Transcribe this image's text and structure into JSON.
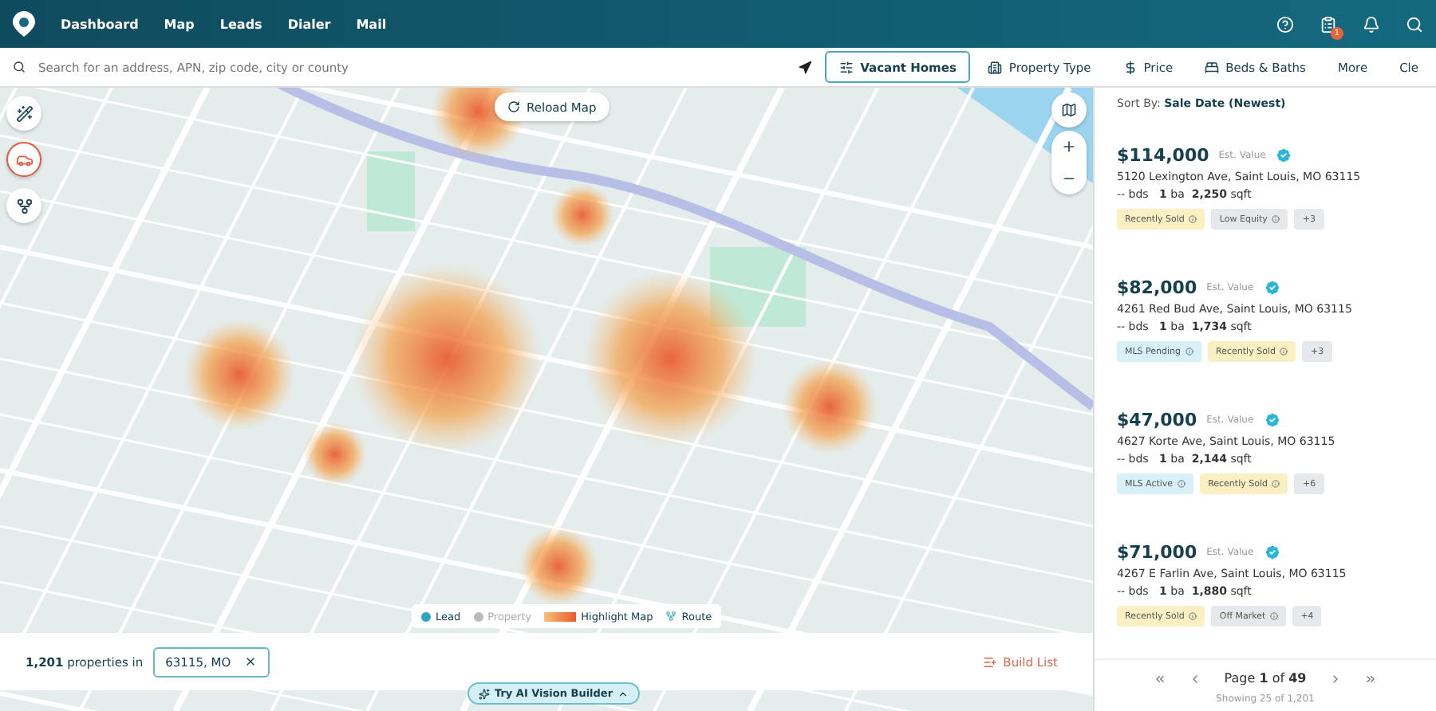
{
  "nav": {
    "items": [
      {
        "label": "Dashboard"
      },
      {
        "label": "Map"
      },
      {
        "label": "Leads"
      },
      {
        "label": "Dialer"
      },
      {
        "label": "Mail"
      }
    ],
    "notification_count": "1"
  },
  "search": {
    "placeholder": "Search for an address, APN, zip code, city or county"
  },
  "filters": [
    {
      "label": "Vacant Homes",
      "selected": true
    },
    {
      "label": "Property Type",
      "selected": false
    },
    {
      "label": "Price",
      "selected": false
    },
    {
      "label": "Beds & Baths",
      "selected": false
    },
    {
      "label": "More",
      "selected": false
    },
    {
      "label": "Cle",
      "selected": false
    }
  ],
  "map": {
    "reload_label": "Reload Map",
    "tools": [
      {
        "selected": false
      },
      {
        "selected": true
      },
      {
        "selected": false
      }
    ],
    "legend": [
      {
        "label": "Lead",
        "kind": "dot",
        "on": true
      },
      {
        "label": "Property",
        "kind": "dot",
        "on": false
      },
      {
        "label": "Highlight Map",
        "kind": "gradient",
        "on": true
      },
      {
        "label": "Route",
        "kind": "route",
        "on": true
      }
    ],
    "count": "1,201",
    "count_suffix": "properties in",
    "location_chip": "63115, MO",
    "build_list": "Build List",
    "ai_button": "Try AI Vision Builder"
  },
  "sort": {
    "label": "Sort By:",
    "value": "Sale Date (Newest)"
  },
  "listings": [
    {
      "price": "$114,000",
      "value_label": "Est. Value",
      "address": "5120 Lexington Ave, Saint Louis, MO 63115",
      "beds": "--",
      "beds_unit": "bds",
      "ba": "1",
      "ba_unit": "ba",
      "sqft": "2,250",
      "sqft_unit": "sqft",
      "tags": [
        {
          "label": "Recently Sold",
          "color": "#fbefc4"
        },
        {
          "label": "Low Equity",
          "color": "#e6e9ec"
        }
      ],
      "more": "+3"
    },
    {
      "price": "$82,000",
      "value_label": "Est. Value",
      "address": "4261 Red Bud Ave, Saint Louis, MO 63115",
      "beds": "--",
      "beds_unit": "bds",
      "ba": "1",
      "ba_unit": "ba",
      "sqft": "1,734",
      "sqft_unit": "sqft",
      "tags": [
        {
          "label": "MLS Pending",
          "color": "#d8f0f7"
        },
        {
          "label": "Recently Sold",
          "color": "#fbefc4"
        }
      ],
      "more": "+3"
    },
    {
      "price": "$47,000",
      "value_label": "Est. Value",
      "address": "4627 Korte Ave, Saint Louis, MO 63115",
      "beds": "--",
      "beds_unit": "bds",
      "ba": "1",
      "ba_unit": "ba",
      "sqft": "2,144",
      "sqft_unit": "sqft",
      "tags": [
        {
          "label": "MLS Active",
          "color": "#d8f0f7"
        },
        {
          "label": "Recently Sold",
          "color": "#fbefc4"
        }
      ],
      "more": "+6"
    },
    {
      "price": "$71,000",
      "value_label": "Est. Value",
      "address": "4267 E Farlin Ave, Saint Louis, MO 63115",
      "beds": "--",
      "beds_unit": "bds",
      "ba": "1",
      "ba_unit": "ba",
      "sqft": "1,880",
      "sqft_unit": "sqft",
      "tags": [
        {
          "label": "Recently Sold",
          "color": "#fbefc4"
        },
        {
          "label": "Off Market",
          "color": "#e6e9ec"
        }
      ],
      "more": "+4"
    }
  ],
  "pagination": {
    "page_word": "Page",
    "page": "1",
    "of_word": "of",
    "total": "49",
    "showing": "Showing 25 of 1,201"
  }
}
